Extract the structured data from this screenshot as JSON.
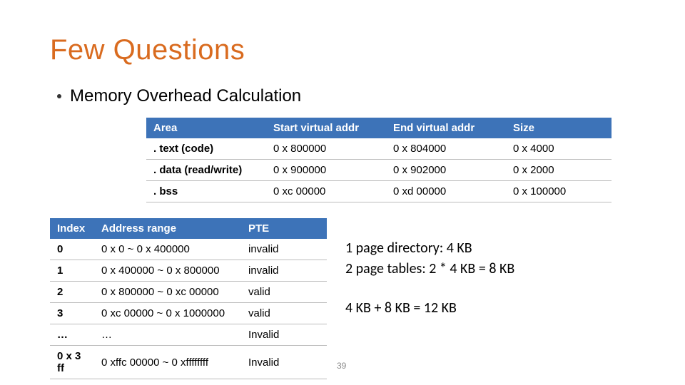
{
  "title": "Few Questions",
  "bullet": "Memory Overhead Calculation",
  "areas": {
    "headers": [
      "Area",
      "Start virtual addr",
      "End virtual addr",
      "Size"
    ],
    "rows": [
      [
        ". text (code)",
        "0 x 800000",
        "0 x 804000",
        "0 x 4000"
      ],
      [
        ". data (read/write)",
        "0 x 900000",
        "0 x 902000",
        "0 x 2000"
      ],
      [
        ". bss",
        "0 xc 00000",
        "0 xd 00000",
        "0 x 100000"
      ]
    ]
  },
  "pte": {
    "headers": [
      "Index",
      "Address range",
      "PTE"
    ],
    "rows": [
      [
        "0",
        "0 x 0 ~ 0 x 400000",
        "invalid"
      ],
      [
        "1",
        "0 x 400000 ~ 0 x 800000",
        "invalid"
      ],
      [
        "2",
        "0 x 800000 ~ 0 xc 00000",
        "valid"
      ],
      [
        "3",
        "0 xc 00000 ~ 0 x 1000000",
        "valid"
      ],
      [
        "…",
        "…",
        "Invalid"
      ],
      [
        "0 x 3 ff",
        "0 xffc 00000 ~ 0 xffffffff",
        "Invalid"
      ]
    ]
  },
  "annot": {
    "l1": "1 page directory: 4 KB",
    "l2": "2 page tables: 2 * 4 KB = 8 KB",
    "l3": "4 KB + 8 KB = 12 KB"
  },
  "pagenum": "39",
  "chart_data": {
    "type": "table",
    "tables": [
      {
        "name": "memory-areas",
        "columns": [
          "Area",
          "Start virtual addr",
          "End virtual addr",
          "Size"
        ],
        "rows": [
          [
            ".text (code)",
            "0x800000",
            "0x804000",
            "0x4000"
          ],
          [
            ".data (read/write)",
            "0x900000",
            "0x902000",
            "0x2000"
          ],
          [
            ".bss",
            "0xc00000",
            "0xd00000",
            "0x100000"
          ]
        ]
      },
      {
        "name": "page-table-entries",
        "columns": [
          "Index",
          "Address range",
          "PTE"
        ],
        "rows": [
          [
            "0",
            "0x0 ~ 0x400000",
            "invalid"
          ],
          [
            "1",
            "0x400000 ~ 0x800000",
            "invalid"
          ],
          [
            "2",
            "0x800000 ~ 0xc00000",
            "valid"
          ],
          [
            "3",
            "0xc00000 ~ 0x1000000",
            "valid"
          ],
          [
            "…",
            "…",
            "Invalid"
          ],
          [
            "0x3ff",
            "0xffc00000 ~ 0xffffffff",
            "Invalid"
          ]
        ]
      }
    ],
    "calculation": {
      "page_directory": "4 KB",
      "page_tables": "2 * 4 KB = 8 KB",
      "total": "12 KB"
    }
  }
}
